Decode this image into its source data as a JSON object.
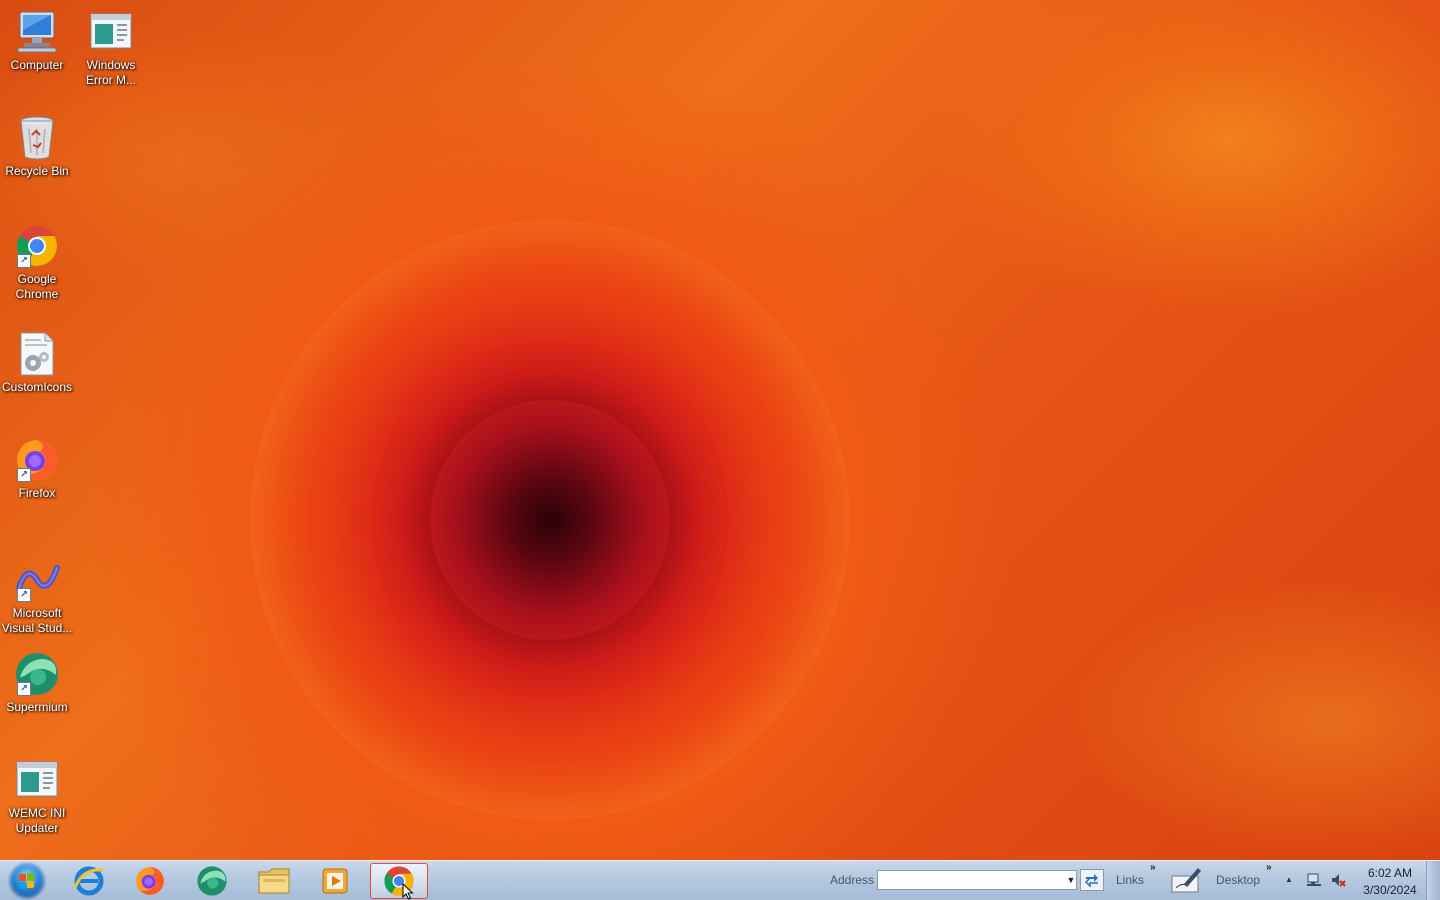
{
  "desktop": {
    "icons": [
      {
        "label": "Computer",
        "icon": "computer-icon"
      },
      {
        "label": "Windows Error M...",
        "icon": "document-window-icon"
      },
      {
        "label": "Recycle Bin",
        "icon": "recycle-bin-icon"
      },
      {
        "label": "Google Chrome",
        "icon": "chrome-icon"
      },
      {
        "label": "CustomIcons",
        "icon": "settings-file-icon"
      },
      {
        "label": "Firefox",
        "icon": "firefox-icon"
      },
      {
        "label": "Microsoft Visual Stud...",
        "icon": "visual-studio-icon"
      },
      {
        "label": "Supermium",
        "icon": "supermium-icon"
      },
      {
        "label": "WEMC INI Updater",
        "icon": "document-window-icon"
      }
    ]
  },
  "taskbar": {
    "pinned": [
      {
        "name": "Internet Explorer",
        "icon": "ie-icon"
      },
      {
        "name": "Firefox",
        "icon": "firefox-icon"
      },
      {
        "name": "Supermium",
        "icon": "supermium-icon"
      },
      {
        "name": "Windows Explorer",
        "icon": "folder-icon"
      },
      {
        "name": "Media Player",
        "icon": "media-player-icon"
      },
      {
        "name": "Google Chrome",
        "icon": "chrome-icon",
        "active": true
      }
    ],
    "address_label": "Address",
    "address_value": "",
    "links_label": "Links",
    "desktop_label": "Desktop",
    "overflow_glyph": "»",
    "tray_up_glyph": "▲",
    "clock": {
      "time": "6:02 AM",
      "date": "3/30/2024"
    }
  },
  "colors": {
    "taskbar_top": "#c9d8ea",
    "taskbar_bottom": "#a6bcd7",
    "active_border": "#e34a3a",
    "label_text": "#ffffff"
  }
}
